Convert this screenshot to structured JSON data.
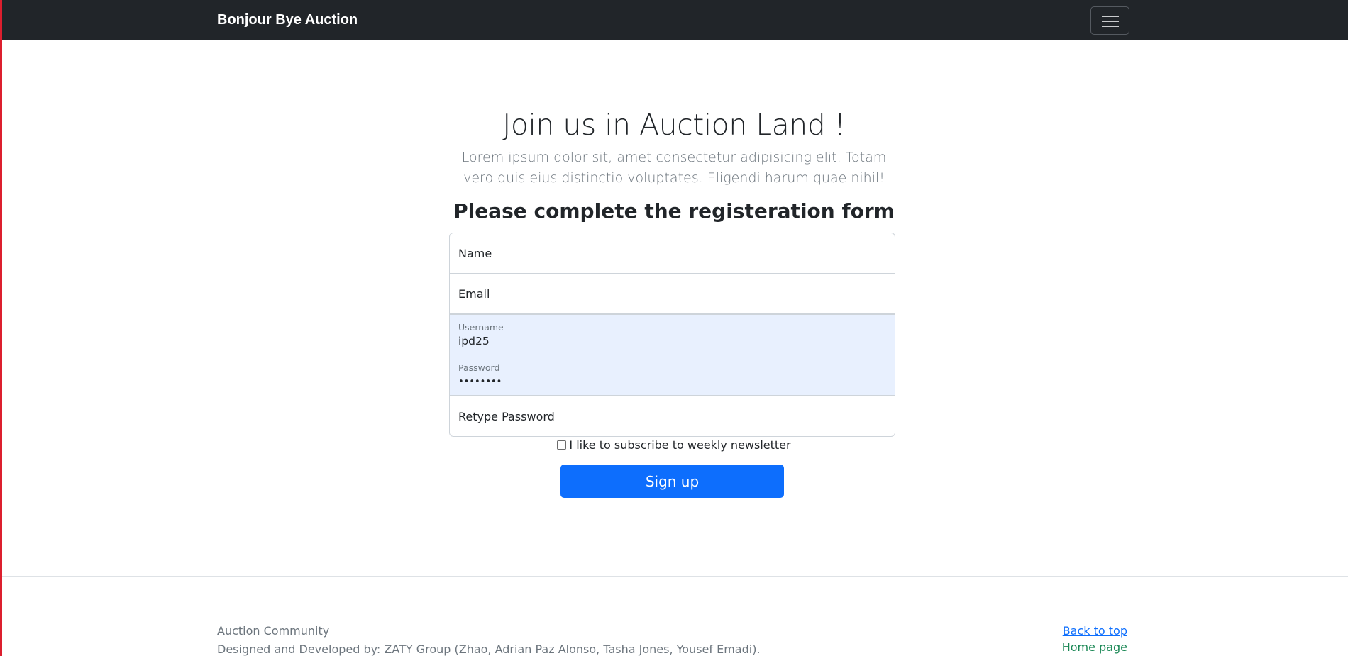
{
  "navbar": {
    "brand": "Bonjour Bye Auction",
    "toggler_icon": "hamburger-icon"
  },
  "hero": {
    "title": "Join us in Auction Land !",
    "lead": "Lorem ipsum dolor sit, amet consectetur adipisicing elit. Totam vero quis eius distinctio voluptates. Eligendi harum quae nihil!"
  },
  "form": {
    "heading": "Please complete the registeration form",
    "name_placeholder": "Name",
    "email_placeholder": "Email",
    "username_label": "Username",
    "username_value": "ipd25",
    "password_label": "Password",
    "password_value": "••••••••",
    "retype_placeholder": "Retype Password",
    "newsletter_label": "I like to subscribe to weekly newsletter",
    "submit_label": "Sign up"
  },
  "footer": {
    "community": "Auction Community",
    "credits": "Designed and Developed by: ZATY Group (Zhao, Adrian Paz Alonso, Tasha Jones, Yousef Emadi).",
    "back_to_top": "Back to top",
    "home_page": "Home page"
  },
  "colors": {
    "navbar": "#212529",
    "primary": "#0d6efd",
    "autofill": "#e8f0fe",
    "muted": "#6c757d",
    "home_link": "#198754"
  }
}
